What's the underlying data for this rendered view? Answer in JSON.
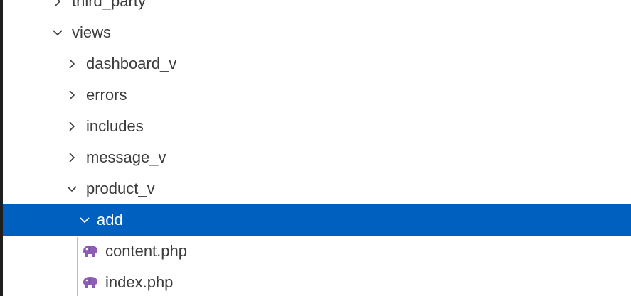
{
  "explorer": {
    "items": [
      {
        "label": "third_party",
        "state": "collapsed",
        "kind": "folder",
        "icon": "chevron-right-icon",
        "depth": 1
      },
      {
        "label": "views",
        "state": "expanded",
        "kind": "folder",
        "icon": "chevron-down-icon",
        "depth": 1
      },
      {
        "label": "dashboard_v",
        "state": "collapsed",
        "kind": "folder",
        "icon": "chevron-right-icon",
        "depth": 2
      },
      {
        "label": "errors",
        "state": "collapsed",
        "kind": "folder",
        "icon": "chevron-right-icon",
        "depth": 2
      },
      {
        "label": "includes",
        "state": "collapsed",
        "kind": "folder",
        "icon": "chevron-right-icon",
        "depth": 2
      },
      {
        "label": "message_v",
        "state": "collapsed",
        "kind": "folder",
        "icon": "chevron-right-icon",
        "depth": 2
      },
      {
        "label": "product_v",
        "state": "expanded",
        "kind": "folder",
        "icon": "chevron-down-icon",
        "depth": 2
      },
      {
        "label": "add",
        "state": "expanded",
        "kind": "folder",
        "icon": "chevron-down-icon",
        "depth": 3,
        "selected": true
      },
      {
        "label": "content.php",
        "kind": "file",
        "icon": "php-elephant-icon",
        "depth": 4
      },
      {
        "label": "index.php",
        "kind": "file",
        "icon": "php-elephant-icon",
        "depth": 4
      }
    ]
  },
  "colors": {
    "selection_bg": "#0060c0",
    "selection_fg": "#ffffff",
    "text": "#3b3b3b",
    "php_icon": "#8d5cb5"
  }
}
